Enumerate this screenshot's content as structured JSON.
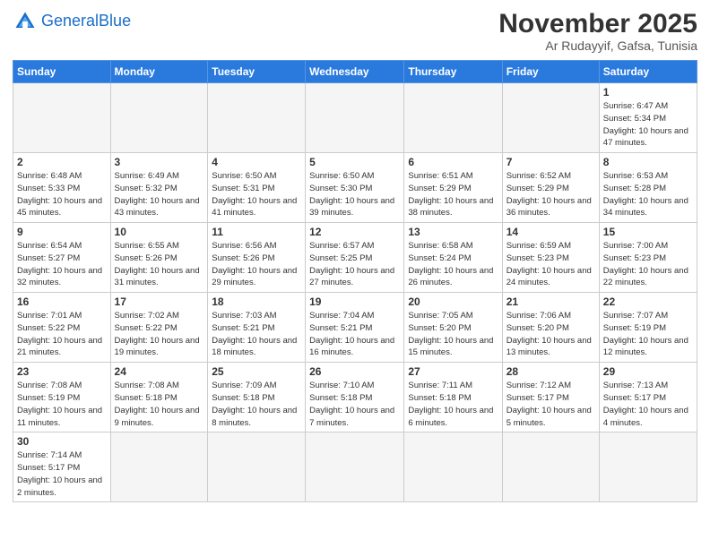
{
  "logo": {
    "text_general": "General",
    "text_blue": "Blue"
  },
  "title": "November 2025",
  "location": "Ar Rudayyif, Gafsa, Tunisia",
  "days_of_week": [
    "Sunday",
    "Monday",
    "Tuesday",
    "Wednesday",
    "Thursday",
    "Friday",
    "Saturday"
  ],
  "weeks": [
    [
      {
        "day": "",
        "empty": true
      },
      {
        "day": "",
        "empty": true
      },
      {
        "day": "",
        "empty": true
      },
      {
        "day": "",
        "empty": true
      },
      {
        "day": "",
        "empty": true
      },
      {
        "day": "",
        "empty": true
      },
      {
        "day": "1",
        "sunrise": "6:47 AM",
        "sunset": "5:34 PM",
        "daylight": "10 hours and 47 minutes."
      }
    ],
    [
      {
        "day": "2",
        "sunrise": "6:48 AM",
        "sunset": "5:33 PM",
        "daylight": "10 hours and 45 minutes."
      },
      {
        "day": "3",
        "sunrise": "6:49 AM",
        "sunset": "5:32 PM",
        "daylight": "10 hours and 43 minutes."
      },
      {
        "day": "4",
        "sunrise": "6:50 AM",
        "sunset": "5:31 PM",
        "daylight": "10 hours and 41 minutes."
      },
      {
        "day": "5",
        "sunrise": "6:50 AM",
        "sunset": "5:30 PM",
        "daylight": "10 hours and 39 minutes."
      },
      {
        "day": "6",
        "sunrise": "6:51 AM",
        "sunset": "5:29 PM",
        "daylight": "10 hours and 38 minutes."
      },
      {
        "day": "7",
        "sunrise": "6:52 AM",
        "sunset": "5:29 PM",
        "daylight": "10 hours and 36 minutes."
      },
      {
        "day": "8",
        "sunrise": "6:53 AM",
        "sunset": "5:28 PM",
        "daylight": "10 hours and 34 minutes."
      }
    ],
    [
      {
        "day": "9",
        "sunrise": "6:54 AM",
        "sunset": "5:27 PM",
        "daylight": "10 hours and 32 minutes."
      },
      {
        "day": "10",
        "sunrise": "6:55 AM",
        "sunset": "5:26 PM",
        "daylight": "10 hours and 31 minutes."
      },
      {
        "day": "11",
        "sunrise": "6:56 AM",
        "sunset": "5:26 PM",
        "daylight": "10 hours and 29 minutes."
      },
      {
        "day": "12",
        "sunrise": "6:57 AM",
        "sunset": "5:25 PM",
        "daylight": "10 hours and 27 minutes."
      },
      {
        "day": "13",
        "sunrise": "6:58 AM",
        "sunset": "5:24 PM",
        "daylight": "10 hours and 26 minutes."
      },
      {
        "day": "14",
        "sunrise": "6:59 AM",
        "sunset": "5:23 PM",
        "daylight": "10 hours and 24 minutes."
      },
      {
        "day": "15",
        "sunrise": "7:00 AM",
        "sunset": "5:23 PM",
        "daylight": "10 hours and 22 minutes."
      }
    ],
    [
      {
        "day": "16",
        "sunrise": "7:01 AM",
        "sunset": "5:22 PM",
        "daylight": "10 hours and 21 minutes."
      },
      {
        "day": "17",
        "sunrise": "7:02 AM",
        "sunset": "5:22 PM",
        "daylight": "10 hours and 19 minutes."
      },
      {
        "day": "18",
        "sunrise": "7:03 AM",
        "sunset": "5:21 PM",
        "daylight": "10 hours and 18 minutes."
      },
      {
        "day": "19",
        "sunrise": "7:04 AM",
        "sunset": "5:21 PM",
        "daylight": "10 hours and 16 minutes."
      },
      {
        "day": "20",
        "sunrise": "7:05 AM",
        "sunset": "5:20 PM",
        "daylight": "10 hours and 15 minutes."
      },
      {
        "day": "21",
        "sunrise": "7:06 AM",
        "sunset": "5:20 PM",
        "daylight": "10 hours and 13 minutes."
      },
      {
        "day": "22",
        "sunrise": "7:07 AM",
        "sunset": "5:19 PM",
        "daylight": "10 hours and 12 minutes."
      }
    ],
    [
      {
        "day": "23",
        "sunrise": "7:08 AM",
        "sunset": "5:19 PM",
        "daylight": "10 hours and 11 minutes."
      },
      {
        "day": "24",
        "sunrise": "7:08 AM",
        "sunset": "5:18 PM",
        "daylight": "10 hours and 9 minutes."
      },
      {
        "day": "25",
        "sunrise": "7:09 AM",
        "sunset": "5:18 PM",
        "daylight": "10 hours and 8 minutes."
      },
      {
        "day": "26",
        "sunrise": "7:10 AM",
        "sunset": "5:18 PM",
        "daylight": "10 hours and 7 minutes."
      },
      {
        "day": "27",
        "sunrise": "7:11 AM",
        "sunset": "5:18 PM",
        "daylight": "10 hours and 6 minutes."
      },
      {
        "day": "28",
        "sunrise": "7:12 AM",
        "sunset": "5:17 PM",
        "daylight": "10 hours and 5 minutes."
      },
      {
        "day": "29",
        "sunrise": "7:13 AM",
        "sunset": "5:17 PM",
        "daylight": "10 hours and 4 minutes."
      }
    ],
    [
      {
        "day": "30",
        "sunrise": "7:14 AM",
        "sunset": "5:17 PM",
        "daylight": "10 hours and 2 minutes."
      },
      {
        "day": "",
        "empty": true
      },
      {
        "day": "",
        "empty": true
      },
      {
        "day": "",
        "empty": true
      },
      {
        "day": "",
        "empty": true
      },
      {
        "day": "",
        "empty": true
      },
      {
        "day": "",
        "empty": true
      }
    ]
  ]
}
